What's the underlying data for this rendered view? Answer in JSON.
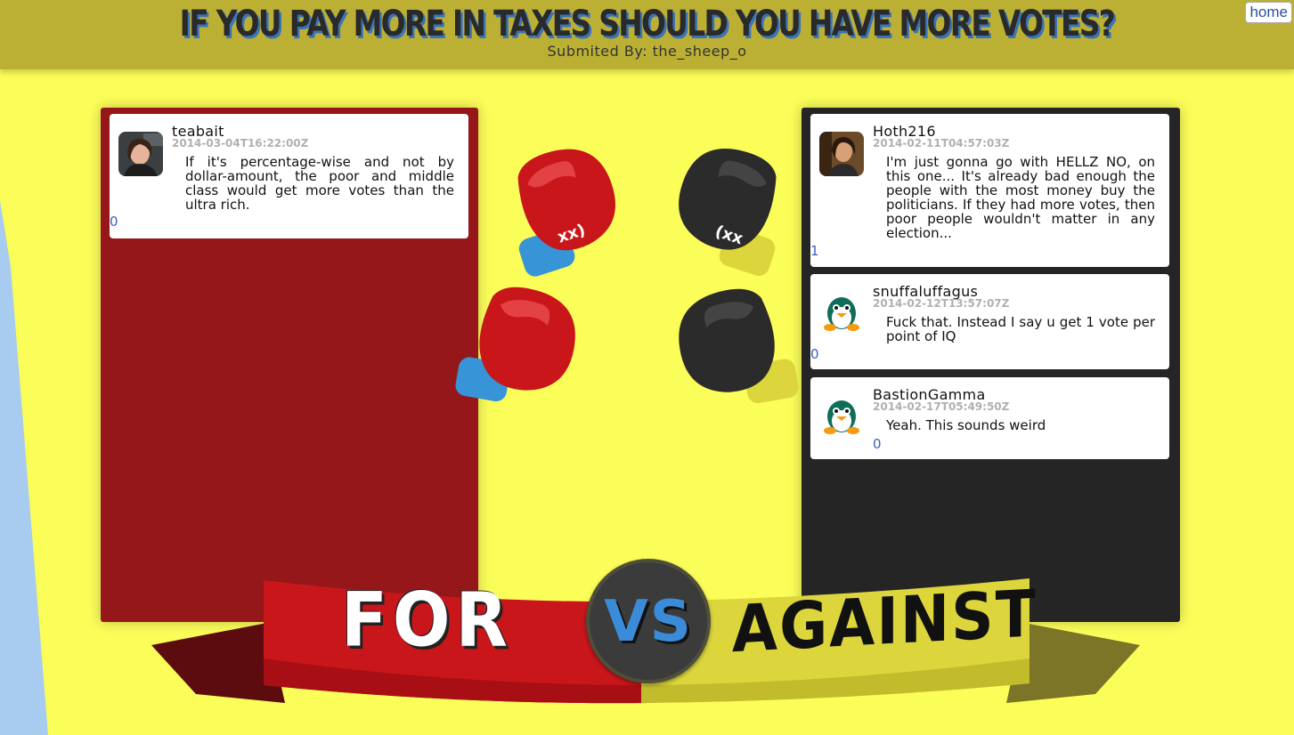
{
  "header": {
    "title": "IF YOU PAY MORE IN TAXES SHOULD YOU HAVE MORE VOTES?",
    "submitted_by": "Submited By: the_sheep_o",
    "home_label": "home"
  },
  "for_side": {
    "comments": [
      {
        "username": "teabait",
        "timestamp": "2014-03-04T16:22:00Z",
        "text": "If it's percentage-wise and not by dollar-amount, the poor and middle class would get more votes than the ultra rich.",
        "votes": "0",
        "avatar": "photo-avatar-icon"
      }
    ]
  },
  "against_side": {
    "comments": [
      {
        "username": "Hoth216",
        "timestamp": "2014-02-11T04:57:03Z",
        "text": "I'm just gonna go with HELLZ NO, on this one... It's already bad enough the people with the most money buy the politicians. If they had more votes, then poor people wouldn't matter in any election...",
        "votes": "1",
        "avatar": "photo-avatar-icon"
      },
      {
        "username": "snuffaluffagus",
        "timestamp": "2014-02-12T13:57:07Z",
        "text": "Fuck that. Instead I say u get 1 vote per point of IQ",
        "votes": "0",
        "avatar": "penguin-avatar-icon"
      },
      {
        "username": "BastionGamma",
        "timestamp": "2014-02-17T05:49:50Z",
        "text": "Yeah. This sounds weird",
        "votes": "0",
        "avatar": "penguin-avatar-icon"
      }
    ]
  },
  "banner": {
    "for_label": "FOR",
    "vs_label": "VS",
    "against_label": "AGAINST"
  },
  "glove_text": {
    "left_glove": "xx)",
    "right_glove": "(xx"
  },
  "colors": {
    "background": "#fbfd59",
    "header_bar": "#bcb034",
    "for_panel": "#95171a",
    "against_panel": "#252525",
    "for_red": "#c4171b",
    "against_yellow": "#dcd63c",
    "vs_blue": "#3a8cd8"
  }
}
